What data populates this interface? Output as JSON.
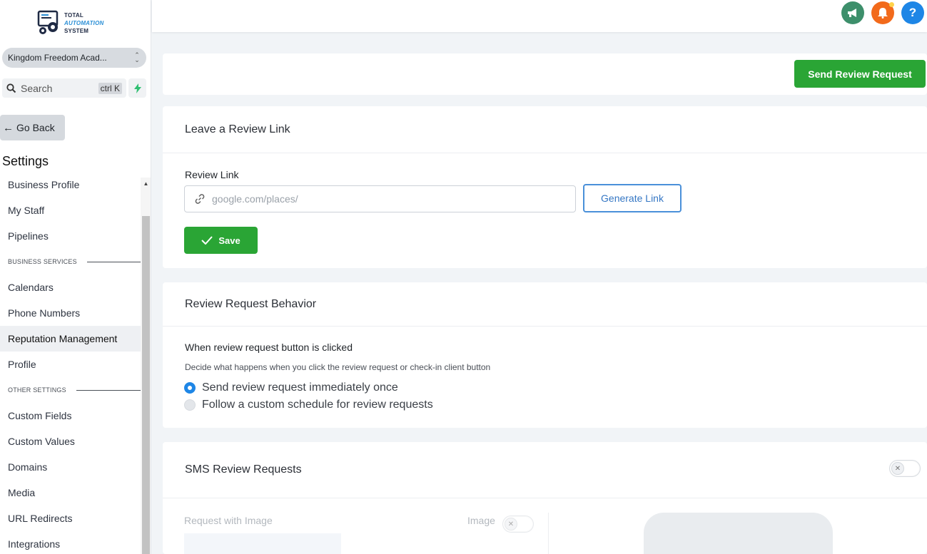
{
  "brand": {
    "logo_line1": "TOTAL",
    "logo_line2": "AUTOMATION",
    "logo_line3": "SYSTEM"
  },
  "sidebar": {
    "account_name": "Kingdom Freedom Acad...",
    "search_label": "Search",
    "search_shortcut": "ctrl K",
    "go_back_label": "Go Back",
    "settings_title": "Settings",
    "items": [
      {
        "type": "item",
        "label": "Business Profile"
      },
      {
        "type": "item",
        "label": "My Staff"
      },
      {
        "type": "item",
        "label": "Pipelines"
      },
      {
        "type": "section",
        "label": "BUSINESS SERVICES"
      },
      {
        "type": "item",
        "label": "Calendars"
      },
      {
        "type": "item",
        "label": "Phone Numbers"
      },
      {
        "type": "item",
        "label": "Reputation Management",
        "active": true
      },
      {
        "type": "item",
        "label": "Profile"
      },
      {
        "type": "section",
        "label": "OTHER SETTINGS"
      },
      {
        "type": "item",
        "label": "Custom Fields"
      },
      {
        "type": "item",
        "label": "Custom Values"
      },
      {
        "type": "item",
        "label": "Domains"
      },
      {
        "type": "item",
        "label": "Media"
      },
      {
        "type": "item",
        "label": "URL Redirects"
      },
      {
        "type": "item",
        "label": "Integrations"
      }
    ]
  },
  "topbar": {
    "icons": [
      "megaphone-icon",
      "bell-icon",
      "help-icon"
    ],
    "colors": {
      "announce": "#3d8f6b",
      "bell": "#f26a1b",
      "help": "#1e86e6"
    }
  },
  "actions": {
    "send_review_request_label": "Send Review Request"
  },
  "review_link": {
    "title": "Leave a Review Link",
    "field_label": "Review Link",
    "placeholder": "google.com/places/",
    "value": "",
    "generate_label": "Generate Link",
    "save_label": "Save"
  },
  "behavior": {
    "title": "Review Request Behavior",
    "question": "When review request button is clicked",
    "description": "Decide what happens when you click the review request or check-in client button",
    "options": [
      {
        "label": "Send review request immediately once",
        "selected": true
      },
      {
        "label": "Follow a custom schedule for review requests",
        "selected": false
      }
    ]
  },
  "sms": {
    "title": "SMS Review Requests",
    "enabled": false,
    "request_with_image_label": "Request with Image",
    "image_label": "Image",
    "image_enabled": false
  },
  "colors": {
    "primary_green": "#2aa535",
    "primary_blue": "#1e86e6"
  }
}
